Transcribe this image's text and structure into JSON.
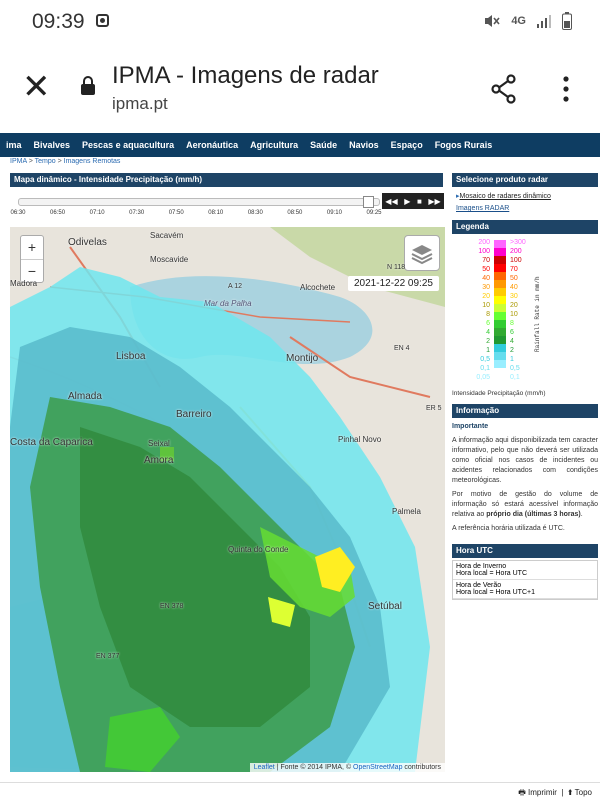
{
  "status_bar": {
    "time": "09:39",
    "network": "4G"
  },
  "browser": {
    "page_title": "IPMA - Imagens de radar",
    "domain": "ipma.pt"
  },
  "nav": {
    "items": [
      "ima",
      "Bivalves",
      "Pescas e aquacultura",
      "Aeronáutica",
      "Agricultura",
      "Saúde",
      "Navios",
      "Espaço",
      "Fogos Rurais"
    ]
  },
  "breadcrumb": {
    "items": [
      "IPMA",
      "Tempo",
      "Imagens Remotas"
    ],
    "separator": ">"
  },
  "main": {
    "header": "Mapa dinâmico - Intensidade Precipitação (mm/h)",
    "timeline_ticks": [
      "06:30",
      "06:50",
      "07:10",
      "07:30",
      "07:50",
      "08:10",
      "08:30",
      "08:50",
      "09:10",
      "09:25"
    ],
    "timeline_progress": 0.98,
    "timestamp": "2021-12-22 09:25",
    "zoom_in": "+",
    "zoom_out": "−",
    "attribution": {
      "leaflet": "Leaflet",
      "text": " | Fonte © 2014 IPMA, © ",
      "osm": "OpenStreetMap",
      "suffix": " contributors"
    },
    "places": [
      "Odivelas",
      "Sacavém",
      "Moscavide",
      "Alcochete",
      "Mar da Palha",
      "Lisboa",
      "Montijo",
      "Almada",
      "Barreiro",
      "Seixal",
      "Amora",
      "Pinhal Novo",
      "Palmela",
      "Quinta do Conde",
      "Setúbal",
      "Costa da Caparica",
      "Madora",
      "N 118",
      "EN 4",
      "ER 5",
      "A 12",
      "EN 377",
      "EN 378"
    ]
  },
  "sidebar": {
    "product_header": "Selecione produto radar",
    "product_link_1": "Mosaico de radares dinâmico",
    "product_link_2": "Imagens RADAR",
    "legend_header": "Legenda",
    "legend_left": [
      "200",
      "100",
      "70",
      "50",
      "40",
      "30",
      "20",
      "10",
      "8",
      "6",
      "4",
      "2",
      "1",
      "0,5",
      "0,1",
      "0,05"
    ],
    "legend_right": [
      ">300",
      "200",
      "100",
      "70",
      "50",
      "40",
      "30",
      "20",
      "10",
      "8",
      "6",
      "4",
      "2",
      "1",
      "0,5",
      "0,1"
    ],
    "legend_colors": [
      "#ff66ff",
      "#ff00cc",
      "#cc0000",
      "#ff0000",
      "#ff6600",
      "#ff9900",
      "#ffcc00",
      "#ffff00",
      "#ccff33",
      "#66ff33",
      "#33cc33",
      "#33aa33",
      "#229933",
      "#33ccdd",
      "#66ddee",
      "#99eeff"
    ],
    "legend_vertical": "Rainfall Rate in mm/h",
    "legend_caption": "Intensidade Precipitação (mm/h)",
    "info_header": "Informação",
    "info_important": "Importante",
    "info_p1": "A informação aqui disponibilizada tem caracter informativo, pelo que não deverá ser utilizada como oficial nos casos de incidentes ou acidentes relacionados com condições meteorológicas.",
    "info_p2_a": "Por motivo de gestão do volume de informação só estará acessível informação relativa ao ",
    "info_p2_b": "próprio dia (últimas 3 horas)",
    "info_p2_c": ".",
    "info_p3": "A referência horária utilizada é UTC.",
    "utc_header": "Hora UTC",
    "utc_winter_1": "Hora de Inverno",
    "utc_winter_2": "Hora local = Hora UTC",
    "utc_summer_1": "Hora de Verão",
    "utc_summer_2": "Hora local = Hora UTC+1"
  },
  "footer": {
    "print": "Imprimir",
    "top": "Topo"
  }
}
